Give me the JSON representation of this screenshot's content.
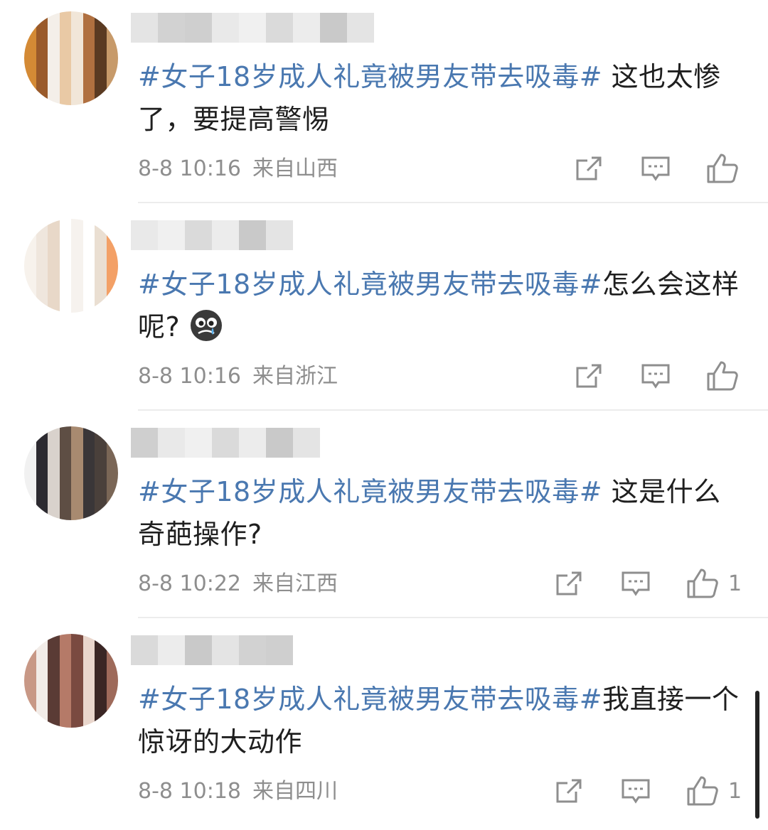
{
  "comments": [
    {
      "hashtag": "#女子18岁成人礼竟被男友带去吸毒#",
      "text": " 这也太惨了，要提高警惕",
      "time": "8-8 10:16",
      "location": "来自山西",
      "likes": ""
    },
    {
      "hashtag": "#女子18岁成人礼竟被男友带去吸毒#",
      "text": "怎么会这样呢?",
      "emoji": "crying-emoji",
      "time": "8-8 10:16",
      "location": "来自浙江",
      "likes": ""
    },
    {
      "hashtag": "#女子18岁成人礼竟被男友带去吸毒#",
      "text": " 这是什么奇葩操作?",
      "time": "8-8 10:22",
      "location": "来自江西",
      "likes": "1"
    },
    {
      "hashtag": "#女子18岁成人礼竟被男友带去吸毒#",
      "text": "我直接一个惊讶的大动作",
      "time": "8-8 10:18",
      "location": "来自四川",
      "likes": "1"
    }
  ],
  "icons": {
    "share": "share-icon",
    "reply": "comment-icon",
    "like": "thumbs-up-icon"
  },
  "colors": {
    "hashtag": "#4a78b0",
    "meta": "#8e8e8e",
    "text": "#1f1f1f",
    "divider": "#ececec"
  }
}
